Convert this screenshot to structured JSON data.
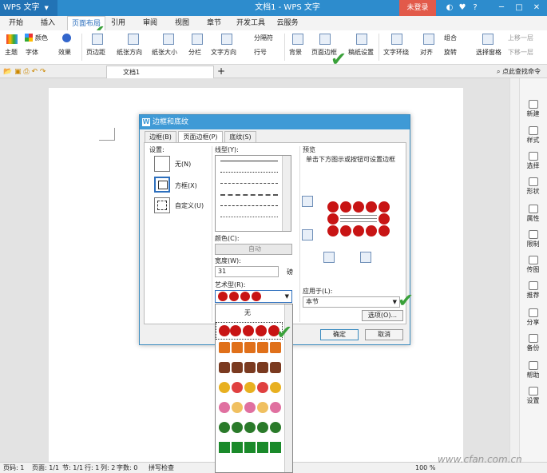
{
  "titlebar": {
    "app_menu": "WPS 文字",
    "doc_title": "文档1 - WPS 文字",
    "login": "未登录",
    "minimize": "─",
    "restore": "□",
    "close": "✕"
  },
  "menu_tabs": [
    "开始",
    "插入",
    "页面布局",
    "引用",
    "审阅",
    "视图",
    "章节",
    "开发工具",
    "云服务"
  ],
  "menu_active": "页面布局",
  "ribbon": {
    "theme": "主题",
    "color": "颜色",
    "font": "字体",
    "effect": "效果",
    "margin": "页边距",
    "orientation": "纸张方向",
    "paper_size": "纸张大小",
    "columns": "分栏",
    "text_direction": "文字方向",
    "separator": "分隔符",
    "line_number": "行号",
    "background": "背景",
    "page_border": "页面边框",
    "manuscript": "稿纸设置",
    "wrap": "文字环绕",
    "align": "对齐",
    "group": "组合",
    "rotate": "旋转",
    "select_pane": "选择窗格",
    "bring_forward": "上移一层",
    "send_backward": "下移一层"
  },
  "tabbar": {
    "doc_tab": "文档1",
    "add": "+",
    "search": "点此查找命令"
  },
  "right_panel": [
    "新建",
    "样式",
    "选择",
    "形状",
    "属性",
    "限制",
    "传图",
    "推荐",
    "分享",
    "备份",
    "帮助",
    "设置"
  ],
  "status": {
    "page": "页码: 1",
    "pages": "页面: 1/1",
    "section": "节: 1/1",
    "row": "行: 1",
    "col": "列: 2",
    "words": "字数: 0",
    "spell": "拼写检查",
    "zoom": "100 %"
  },
  "dialog": {
    "title": "边框和底纹",
    "tabs": [
      "边框(B)",
      "页面边框(P)",
      "底纹(S)"
    ],
    "active_tab": "页面边框(P)",
    "settings_label": "设置:",
    "setting_none": "无(N)",
    "setting_box": "方框(X)",
    "setting_custom": "自定义(U)",
    "line_style_label": "线型(Y):",
    "color_label": "颜色(C):",
    "color_value": "自动",
    "width_label": "宽度(W):",
    "width_value": "31",
    "width_unit": "磅",
    "art_label": "艺术型(R):",
    "preview_label": "预览",
    "preview_hint": "单击下方图示或按钮可设置边框",
    "apply_label": "应用于(L):",
    "apply_value": "本节",
    "options_button": "选项(O)...",
    "ok_button": "确定",
    "cancel_button": "取消",
    "art_none": "无"
  },
  "art_options": [
    {
      "name": "apples",
      "color": "#c81414"
    },
    {
      "name": "candles",
      "color": "#e0701a"
    },
    {
      "name": "cakes",
      "color": "#7a3a20"
    },
    {
      "name": "balloons",
      "color": "#e8b020"
    },
    {
      "name": "ice-cream",
      "color": "#e070a0"
    },
    {
      "name": "peppers",
      "color": "#2a7a2a"
    },
    {
      "name": "trees",
      "color": "#1a8a2a"
    }
  ],
  "watermark": "www.cfan.com.cn",
  "colors": {
    "titlebar": "#2d8ccd",
    "accent": "#2d6fbd",
    "login": "#e25a4a",
    "check": "#3aa13a",
    "apple": "#c81414"
  }
}
